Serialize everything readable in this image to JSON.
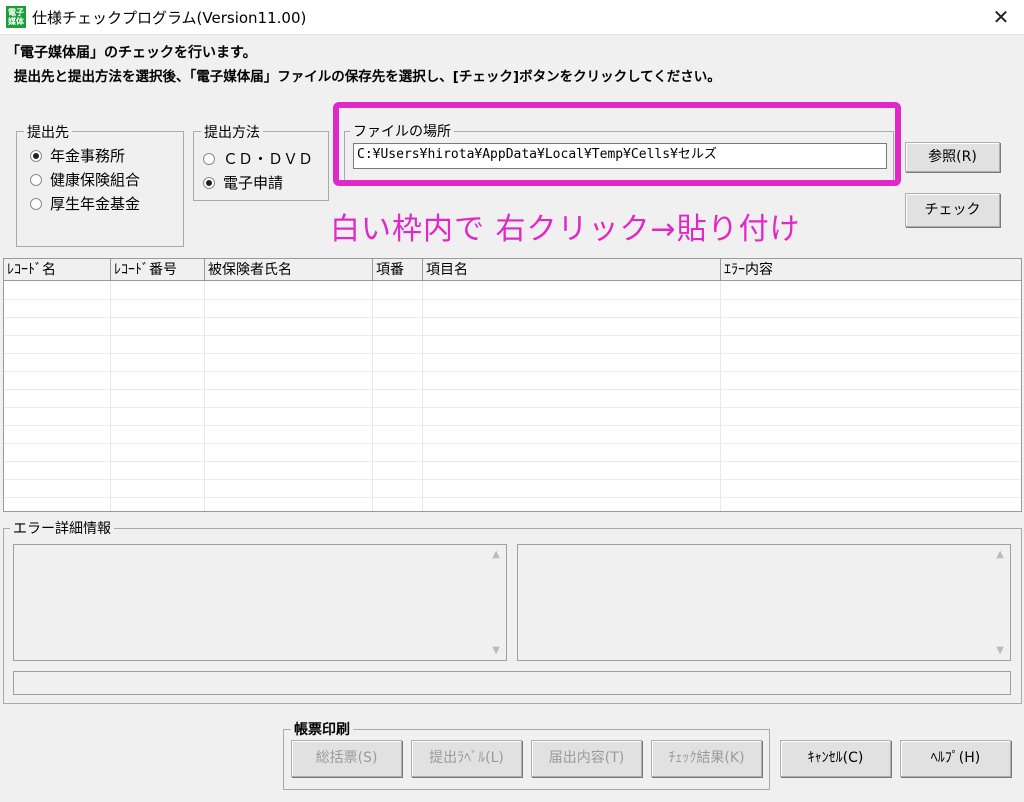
{
  "window": {
    "title": "仕様チェックプログラム(Version11.00)",
    "icon_text": "電子媒体",
    "close_label": "✕"
  },
  "description": {
    "line1": "「電子媒体届」のチェックを行います。",
    "line2": "提出先と提出方法を選択後、「電子媒体届」ファイルの保存先を選択し、[チェック]ボタンをクリックしてください。"
  },
  "destination": {
    "label": "提出先",
    "options": [
      {
        "label": "年金事務所",
        "selected": true
      },
      {
        "label": "健康保険組合",
        "selected": false
      },
      {
        "label": "厚生年金基金",
        "selected": false
      }
    ]
  },
  "method": {
    "label": "提出方法",
    "options": [
      {
        "label": "ＣＤ・ＤＶＤ",
        "selected": false
      },
      {
        "label": "電子申請",
        "selected": true
      }
    ]
  },
  "file_location": {
    "label": "ファイルの場所",
    "value": "C:¥Users¥hirota¥AppData¥Local¥Temp¥Cells¥セルズ",
    "highlight_color": "#e028c8"
  },
  "annotation": {
    "text": "白い枠内で 右クリック→貼り付け"
  },
  "buttons": {
    "browse": "参照(R)",
    "check": "チェック"
  },
  "results_table": {
    "columns": [
      "ﾚｺｰﾄﾞ名",
      "ﾚｺｰﾄﾞ番号",
      "被保険者氏名",
      "項番",
      "項目名",
      "ｴﾗｰ内容"
    ],
    "rows": []
  },
  "error_details": {
    "label": "エラー詳細情報"
  },
  "print_group": {
    "label": "帳票印刷",
    "buttons": [
      "総括票(S)",
      "提出ﾗﾍﾞﾙ(L)",
      "届出内容(T)",
      "ﾁｪｯｸ結果(K)"
    ]
  },
  "footer_buttons": {
    "cancel": "ｷｬﾝｾﾙ(C)",
    "help": "ﾍﾙﾌﾟ(H)"
  }
}
